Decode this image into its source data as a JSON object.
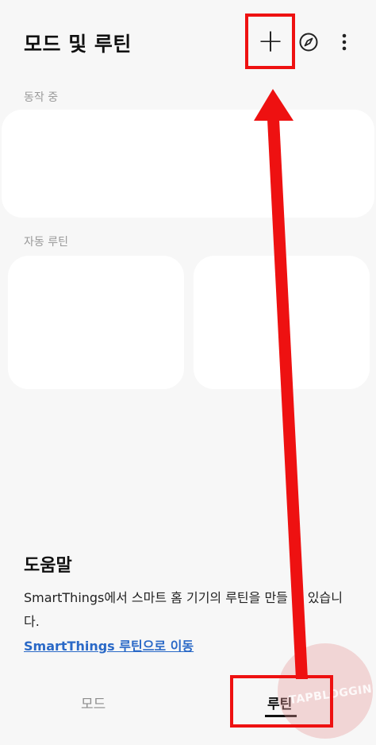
{
  "appbar": {
    "title": "모드 및 루틴",
    "add_icon": "plus-icon",
    "discover_icon": "compass-icon",
    "more_icon": "more-vertical-icon"
  },
  "running": {
    "label": "동작 중"
  },
  "auto_routines": {
    "label": "자동 루틴"
  },
  "help": {
    "title": "도움말",
    "description": "SmartThings에서 스마트 홈 기기의 루틴을 만들 수 있습니다.",
    "link": "SmartThings 루틴으로 이동"
  },
  "bottom_nav": {
    "tabs": [
      {
        "label": "모드",
        "selected": false
      },
      {
        "label": "루틴",
        "selected": true
      }
    ]
  },
  "annotation": {
    "color": "#ee1111"
  },
  "watermark": {
    "text": "TAPBLOGGING"
  }
}
